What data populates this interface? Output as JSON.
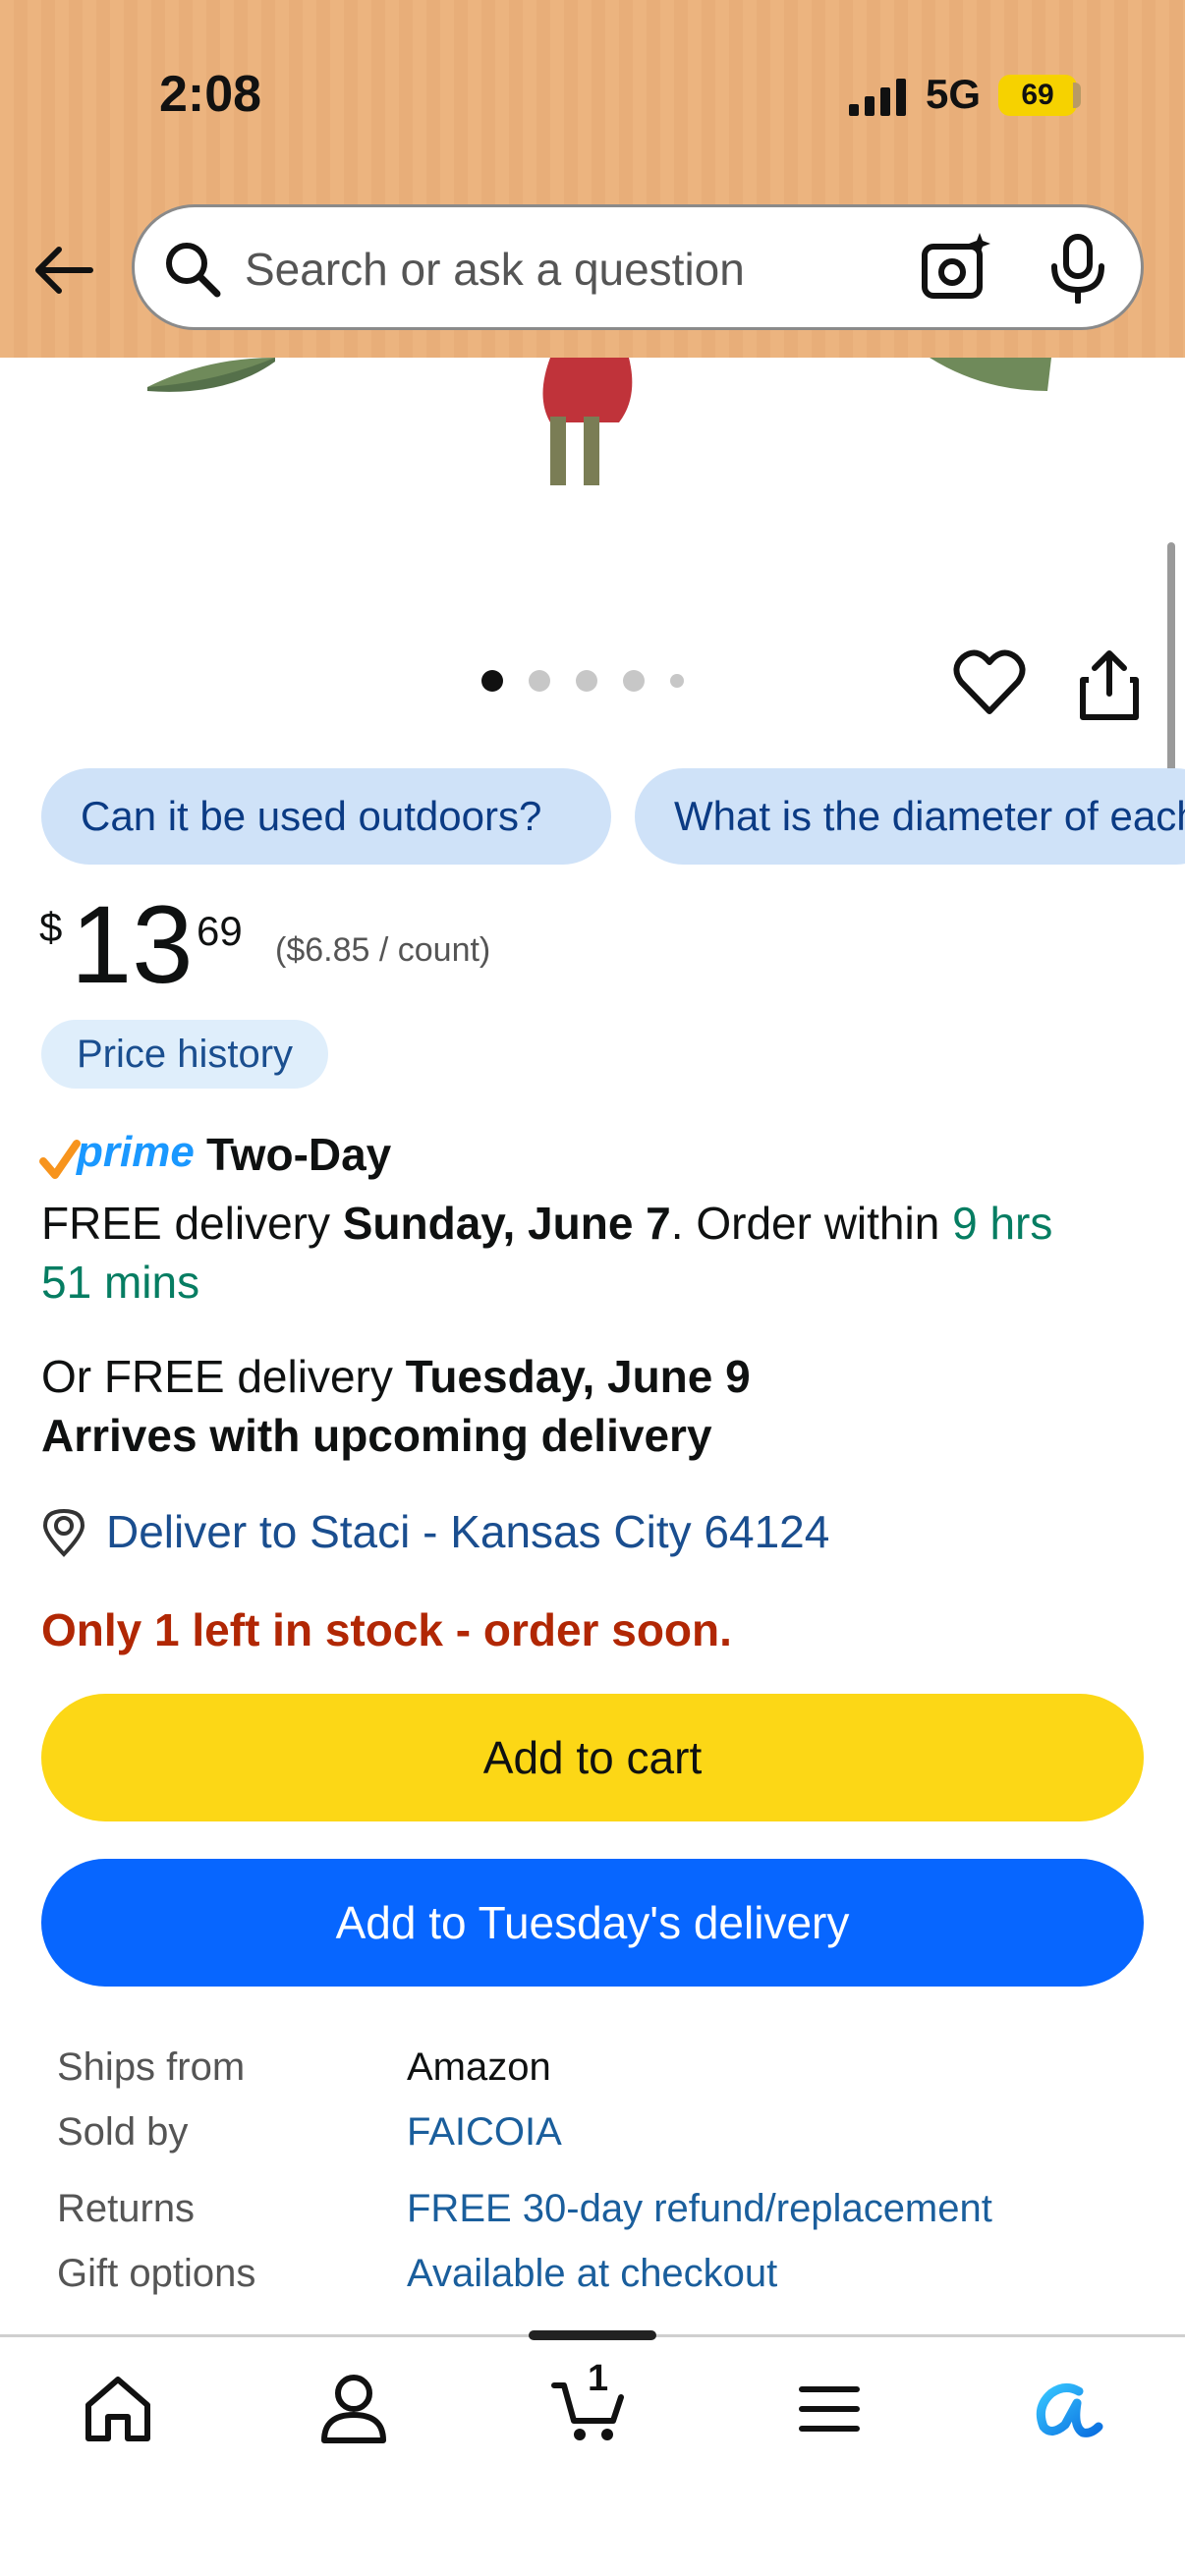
{
  "status_bar": {
    "time": "2:08",
    "network": "5G",
    "battery": "69"
  },
  "search": {
    "placeholder": "Search or ask a question"
  },
  "product_gallery": {
    "image_count_dots": 5,
    "active_index": 0
  },
  "questions": [
    {
      "label": "Can it be used outdoors?"
    },
    {
      "label": "What is the diameter of each"
    }
  ],
  "price": {
    "currency": "$",
    "whole": "13",
    "fraction": "69",
    "unit_price": "($6.85 / count)",
    "history_label": "Price history"
  },
  "delivery": {
    "prime_logo": "prime",
    "prime_speed": "Two-Day",
    "free_label": "FREE delivery ",
    "date": "Sunday, June 7",
    "order_within": ". Order within ",
    "countdown_1": "9 hrs",
    "countdown_2": "51 mins",
    "alt_prefix": "Or FREE delivery ",
    "alt_date": "Tuesday, June 9",
    "alt_note": "Arrives with upcoming delivery",
    "deliver_to": "Deliver to Staci - Kansas City 64124",
    "stock": "Only 1 left in stock - order soon."
  },
  "buttons": {
    "add_to_cart": "Add to cart",
    "add_to_delivery": "Add to Tuesday's delivery"
  },
  "details": [
    {
      "label": "Ships from",
      "value": "Amazon"
    },
    {
      "label": "Sold by",
      "value": "FAICOIA"
    },
    {
      "label": "Returns",
      "value": "FREE 30-day refund/replacement"
    },
    {
      "label": "Gift options",
      "value": "Available at checkout"
    }
  ],
  "nav": {
    "cart_count": "1"
  },
  "colors": {
    "header": "#ecb47f",
    "add_to_cart": "#fcd716",
    "add_to_delivery": "#0766ff",
    "stock_red": "#b12704",
    "countdown_green": "#067d62",
    "link_blue": "#1a4e8f"
  }
}
